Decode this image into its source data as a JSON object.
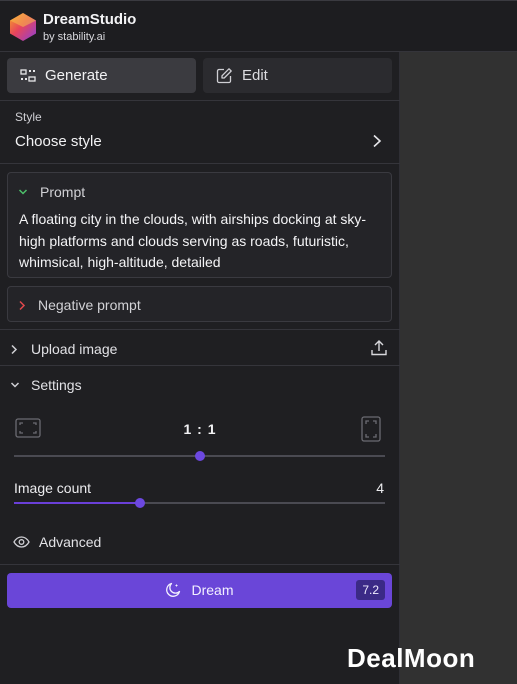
{
  "header": {
    "title": "DreamStudio",
    "subtitle": "by stability.ai"
  },
  "tabs": {
    "generate": "Generate",
    "edit": "Edit"
  },
  "style": {
    "label": "Style",
    "value": "Choose style"
  },
  "prompt": {
    "label": "Prompt",
    "text": "A floating city in the clouds, with airships docking at sky-high platforms and clouds serving as roads, futuristic, whimsical, high-altitude, detailed"
  },
  "negative_prompt": {
    "label": "Negative prompt"
  },
  "upload": {
    "label": "Upload image"
  },
  "settings": {
    "label": "Settings",
    "aspect_ratio": "1 : 1",
    "aspect_ratio_level": 0.5,
    "image_count_label": "Image count",
    "image_count": "4",
    "image_count_level": 0.34,
    "advanced_label": "Advanced"
  },
  "dream": {
    "label": "Dream",
    "cost": "7.2"
  },
  "watermark": "DealMoon",
  "colors": {
    "accent": "#6a46d8",
    "panel": "#1f1f22",
    "badge": "#3b2a86"
  }
}
